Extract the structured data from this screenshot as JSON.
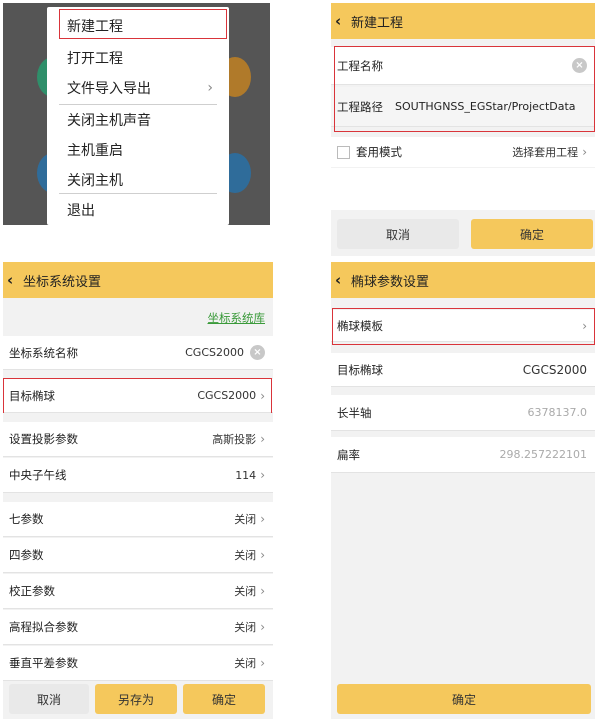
{
  "menu": {
    "items": [
      "新建工程",
      "打开工程",
      "文件导入导出",
      "关闭主机声音",
      "主机重启",
      "关闭主机",
      "退出"
    ],
    "submenu_arrow": "›"
  },
  "new_project": {
    "title": "新建工程",
    "name_label": "工程名称",
    "path_label": "工程路径",
    "path_value": "SOUTHGNSS_EGStar/ProjectData",
    "template_label": "套用模式",
    "template_select": "选择套用工程",
    "cancel": "取消",
    "ok": "确定"
  },
  "coord_system": {
    "title": "坐标系统设置",
    "library_link": "坐标系统库",
    "rows": [
      {
        "label": "坐标系统名称",
        "value": "CGCS2000"
      },
      {
        "label": "目标椭球",
        "value": "CGCS2000"
      },
      {
        "label": "设置投影参数",
        "value": "高斯投影"
      },
      {
        "label": "中央子午线",
        "value": "114"
      },
      {
        "label": "七参数",
        "value": "关闭"
      },
      {
        "label": "四参数",
        "value": "关闭"
      },
      {
        "label": "校正参数",
        "value": "关闭"
      },
      {
        "label": "高程拟合参数",
        "value": "关闭"
      },
      {
        "label": "垂直平差参数",
        "value": "关闭"
      }
    ],
    "cancel": "取消",
    "save_as": "另存为",
    "ok": "确定"
  },
  "ellipsoid": {
    "title": "椭球参数设置",
    "rows": [
      {
        "label": "椭球模板",
        "value": ""
      },
      {
        "label": "目标椭球",
        "value": "CGCS2000"
      },
      {
        "label": "长半轴",
        "value": "6378137.0"
      },
      {
        "label": "扁率",
        "value": "298.257222101"
      }
    ],
    "ok": "确定"
  },
  "icons": {
    "back": "back-chevron-icon",
    "chevron": "chevron-right-icon",
    "clear": "clear-icon",
    "checkbox": "checkbox-icon"
  },
  "colors": {
    "accent": "#f5c85c",
    "highlight": "#d9343a",
    "menu_bg": "#555555"
  }
}
